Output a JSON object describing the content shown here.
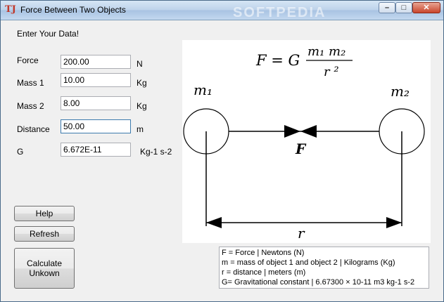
{
  "window": {
    "title": "Force Between Two Objects",
    "icon_text": "TJ",
    "watermark": "SOFTPEDIA"
  },
  "controls": {
    "minimize": "–",
    "maximize": "□",
    "close": "✕"
  },
  "form": {
    "heading": "Enter Your Data!",
    "force": {
      "label": "Force",
      "value": "200.00",
      "unit": "N"
    },
    "mass1": {
      "label": "Mass 1",
      "value": "10.00",
      "unit": "Kg"
    },
    "mass2": {
      "label": "Mass 2",
      "value": "8.00",
      "unit": "Kg"
    },
    "distance": {
      "label": "Distance",
      "value": "50.00",
      "unit": "m"
    },
    "g": {
      "label": "G",
      "value": "6.672E-11",
      "unit": "Kg-1 s-2"
    }
  },
  "buttons": {
    "help": "Help",
    "refresh": "Refresh",
    "calculate_line1": "Calculate",
    "calculate_line2": "Unkown"
  },
  "diagram": {
    "formula_lhs": "F = G",
    "formula_num": "m₁ m₂",
    "formula_den": "r ²",
    "m1_label": "m₁",
    "m2_label": "m₂",
    "force_label": "F",
    "distance_label": "r"
  },
  "legend": [
    "F = Force | Newtons (N)",
    "m = mass of object 1 and object 2 |  Kilograms (Kg)",
    "r = distance | meters (m)",
    "G= Gravitational constant | 6.67300 × 10-11 m3  kg-1 s-2"
  ]
}
